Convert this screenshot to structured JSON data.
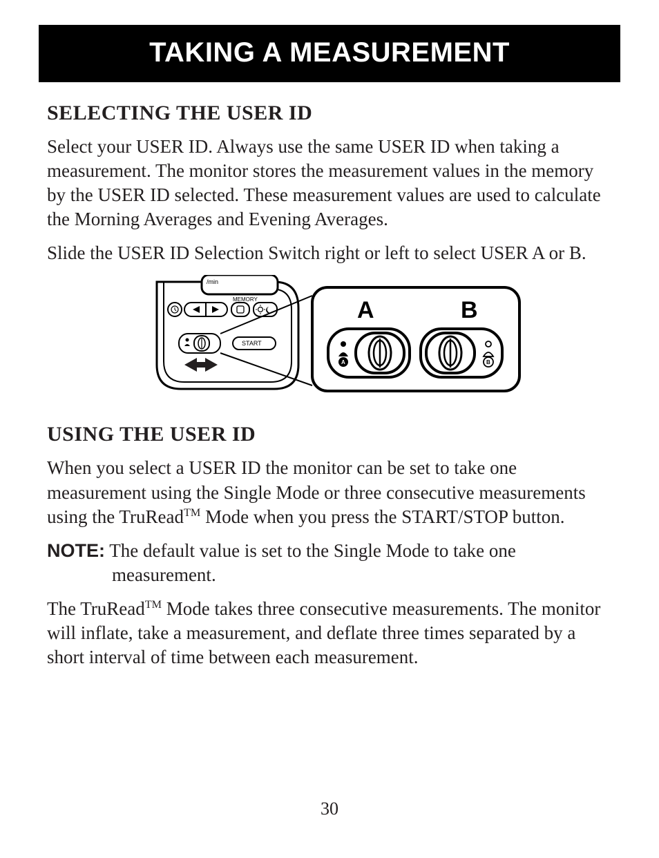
{
  "page": {
    "title": "TAKING A MEASUREMENT",
    "number": "30"
  },
  "section1": {
    "heading": "SELECTING THE USER ID",
    "p1": "Select your USER ID. Always use the same USER ID when taking a measurement. The monitor stores the measurement values in the memory by the USER ID selected. These measurement values are used to calculate the Morning Averages and Evening Averages.",
    "p2": "Slide the USER ID Selection Switch right or left to select USER A or B."
  },
  "diagram": {
    "left_labels": {
      "per_min": "/min",
      "memory": "MEMORY",
      "start": "START"
    },
    "right_labels": {
      "A": "A",
      "B": "B",
      "icon_a": "A",
      "icon_b": "B"
    }
  },
  "section2": {
    "heading": "USING THE USER ID",
    "p1_pre": "When you select a USER ID the monitor can be set to take one measurement using the Single Mode or three consecutive measurements using the TruRead",
    "p1_tm": "TM",
    "p1_post": " Mode when you press the START/STOP button.",
    "note_label": "NOTE:",
    "note_line1": " The default value is set to the Single Mode to take one",
    "note_line2": "measurement.",
    "p3_pre": "The TruRead",
    "p3_tm": "TM",
    "p3_post": " Mode takes three consecutive measurements. The monitor will inflate, take a measurement, and deflate three times separated by a short interval of time between each measurement."
  }
}
